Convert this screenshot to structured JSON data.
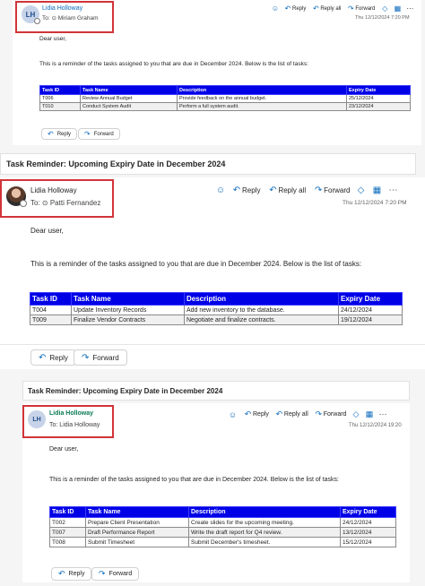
{
  "emails": [
    {
      "subject": "",
      "avatar_initials": "LH",
      "sender": "Lidia Holloway",
      "to_label": "To:",
      "recipient": "Miriam Graham",
      "date": "Thu 12/12/2024 7:20 PM",
      "toolbar": {
        "reply": "Reply",
        "reply_all": "Reply all",
        "forward": "Forward"
      },
      "greeting": "Dear user,",
      "intro": "This is a reminder of the tasks assigned to you that are due in December 2024. Below is the list of tasks:",
      "columns": [
        "Task ID",
        "Task Name",
        "Description",
        "Expiry Date"
      ],
      "rows": [
        [
          "T006",
          "Review Annual Budget",
          "Provide feedback on the annual budget.",
          "25/12/2024"
        ],
        [
          "T010",
          "Conduct System Audit",
          "Perform a full system audit.",
          "23/12/2024"
        ]
      ],
      "footer": {
        "reply": "Reply",
        "forward": "Forward"
      }
    },
    {
      "subject": "Task Reminder: Upcoming Expiry Date in December 2024",
      "avatar_initials": "",
      "sender": "Lidia Holloway",
      "to_label": "To:",
      "recipient": "Patti Fernandez",
      "date": "Thu 12/12/2024 7:20 PM",
      "toolbar": {
        "reply": "Reply",
        "reply_all": "Reply all",
        "forward": "Forward"
      },
      "greeting": "Dear user,",
      "intro": "This is a reminder of the tasks assigned to you that are due in December 2024. Below is the list of tasks:",
      "columns": [
        "Task ID",
        "Task Name",
        "Description",
        "Expiry Date"
      ],
      "rows": [
        [
          "T004",
          "Update Inventory Records",
          "Add new inventory to the database.",
          "24/12/2024"
        ],
        [
          "T009",
          "Finalize Vendor Contracts",
          "Negotiate and finalize contracts.",
          "19/12/2024"
        ]
      ],
      "footer": {
        "reply": "Reply",
        "forward": "Forward"
      }
    },
    {
      "subject": "Task Reminder: Upcoming Expiry Date in December 2024",
      "avatar_initials": "LH",
      "sender": "Lidia Holloway",
      "to_label": "To:",
      "recipient": "Lidia Holloway",
      "date": "Thu 12/12/2024 19:20",
      "toolbar": {
        "reply": "Reply",
        "reply_all": "Reply all",
        "forward": "Forward"
      },
      "greeting": "Dear user,",
      "intro": "This is a reminder of the tasks assigned to you that are due in December 2024. Below is the list of tasks:",
      "columns": [
        "Task ID",
        "Task Name",
        "Description",
        "Expiry Date"
      ],
      "rows": [
        [
          "T002",
          "Prepare Client Presentation",
          "Create slides for the upcoming meeting.",
          "24/12/2024"
        ],
        [
          "T007",
          "Draft Performance Report",
          "Write the draft report for Q4 review.",
          "13/12/2024"
        ],
        [
          "T008",
          "Submit Timesheet",
          "Submit December's timesheet.",
          "15/12/2024"
        ]
      ],
      "footer": {
        "reply": "Reply",
        "forward": "Forward"
      }
    }
  ],
  "icons": {
    "emoji": "☺",
    "reply": "↶",
    "reply_all": "↶",
    "forward": "↷",
    "recipient": "⊙",
    "link": "◇",
    "grid": "▦",
    "more": "⋯"
  },
  "colors": {
    "table_header": "#0000e6",
    "highlight_box": "#d13438",
    "accent": "#0f6cbd"
  }
}
